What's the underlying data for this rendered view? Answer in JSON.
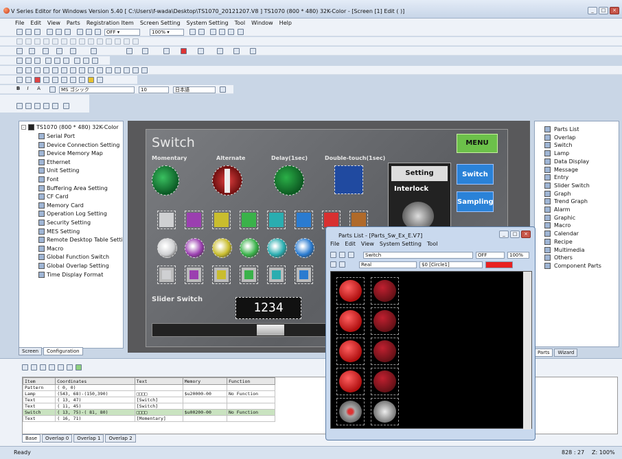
{
  "app": {
    "title": "V Series Editor for Windows Version 5.40 [ C:\\Users\\f-wada\\Desktop\\TS1070_20121207.V8 ] TS1070 (800 * 480) 32K-Color - [Screen [1] Edit (          )]",
    "menu": [
      "File",
      "Edit",
      "View",
      "Parts",
      "Registration Item",
      "Screen Setting",
      "System Setting",
      "Tool",
      "Window",
      "Help"
    ]
  },
  "toolbar": {
    "off_combo": "OFF",
    "zoom_combo": "100%",
    "font_combo": "MS ゴシック",
    "size_combo": "10",
    "lang_combo": "日本語"
  },
  "left_tree": {
    "root": "TS1070 (800 * 480) 32K-Color",
    "items": [
      "Serial Port",
      "Device Connection Setting",
      "Device Memory Map",
      "Ethernet",
      "Unit Setting",
      "Font",
      "Buffering Area Setting",
      "CF Card",
      "Memory Card",
      "Operation Log Setting",
      "Security Setting",
      "MES Setting",
      "Remote Desktop Table Setti",
      "Macro",
      "Global Function Switch",
      "Global Overlap Setting",
      "Time Display Format"
    ],
    "tabs": [
      "Screen",
      "Configuration"
    ]
  },
  "screen": {
    "title": "Switch",
    "menu_button": "MENU",
    "labels": [
      "Momentary",
      "Alternate",
      "Delay(1sec)",
      "Double-touch(1sec)"
    ],
    "setting": "Setting",
    "interlock": "Interlock",
    "side_buttons": [
      "Switch",
      "Sampling"
    ],
    "slider_label": "Slider Switch",
    "numeric": "1234",
    "square_colors": [
      "#cfd0d2",
      "#9b3fb0",
      "#c9bd2e",
      "#3ab24a",
      "#2aadb0",
      "#2a7bd0",
      "#d83030",
      "#b06a2a"
    ]
  },
  "right_tree": {
    "items": [
      "Parts List",
      "Overlap",
      "Switch",
      "Lamp",
      "Data Display",
      "Message",
      "Entry",
      "Slider Switch",
      "Graph",
      "Trend Graph",
      "Alarm",
      "Graphic",
      "Macro",
      "Calendar",
      "Recipe",
      "Multimedia",
      "Others",
      "Component Parts"
    ],
    "tabs": [
      "Parts",
      "Wizard"
    ]
  },
  "grid": {
    "headers": [
      "Item",
      "Coordinates",
      "Text",
      "Memory",
      "Function"
    ],
    "rows": [
      [
        "Pattern",
        "(  0,  0)",
        "",
        "",
        ""
      ],
      [
        "Lamp",
        "(543, 68)-(150,390)",
        "□□□□",
        "$u20000-00",
        "No Function"
      ],
      [
        "Text",
        "( 13, 47)",
        "[Switch]",
        "",
        ""
      ],
      [
        "Text",
        "( 11, 45)",
        "[Switch]",
        "",
        ""
      ],
      [
        "Switch",
        "( 13, 75)-( 81, 80)",
        "□□□□",
        "$u00200-00",
        "No Function"
      ],
      [
        "Text",
        "( 16, 71)",
        "[Momentary]",
        "",
        ""
      ]
    ],
    "tabs": [
      "Base",
      "Overlap 0",
      "Overlap 1",
      "Overlap 2"
    ]
  },
  "parts_window": {
    "title": "Parts List - [Parts_Sw_Ex_E.V7]",
    "menu": [
      "File",
      "Edit",
      "View",
      "System Setting",
      "Tool"
    ],
    "type_combo": "Switch",
    "off_combo": "OFF",
    "zoom_combo": "100%",
    "shape_combo": "Real",
    "name_combo": "$0 [Circle1]"
  },
  "status": {
    "left": "Ready",
    "coords": "828 : 27",
    "zoom": "Z: 100%"
  }
}
